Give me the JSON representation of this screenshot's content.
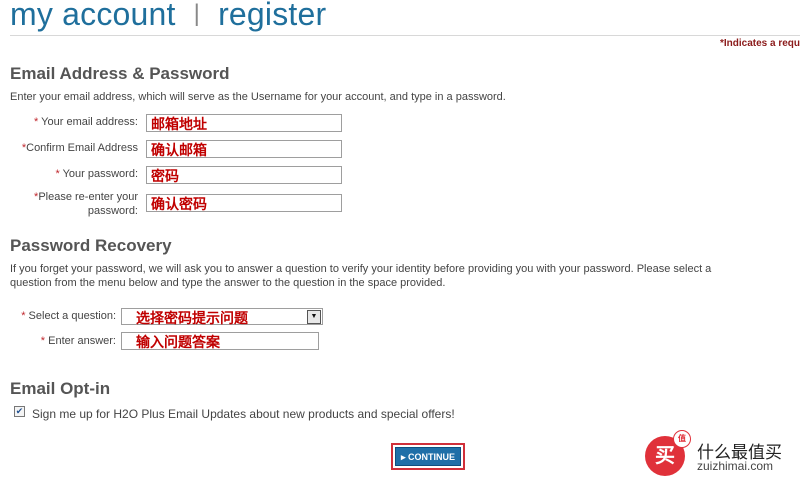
{
  "header": {
    "title_left": "my account",
    "separator": "|",
    "title_right": "register"
  },
  "required_note": "*Indicates a requ",
  "email_section": {
    "heading": "Email Address & Password",
    "description": "Enter your email address, which will serve as the Username for your account, and type in a password.",
    "fields": [
      {
        "star": "*",
        "label": "Your email address:",
        "value": "邮箱地址"
      },
      {
        "star": "*",
        "label": "Confirm Email Address",
        "value": "确认邮箱"
      },
      {
        "star": "*",
        "label": "Your password:",
        "value": "密码"
      },
      {
        "star": "*",
        "label_line1": "Please re-enter your",
        "label_line2": "password:",
        "value": "确认密码"
      }
    ]
  },
  "recovery_section": {
    "heading": "Password Recovery",
    "description_line1": "If you forget your password, we will ask you to answer a question to verify your identity before providing you with your password. Please select a",
    "description_line2": "question from the menu below and type the answer to the question in the space provided.",
    "question": {
      "star": "*",
      "label": "Select a question:",
      "value": "选择密码提示问题"
    },
    "answer": {
      "star": "*",
      "label": "Enter answer:",
      "value": "输入问题答案"
    }
  },
  "optin_section": {
    "heading": "Email Opt-in",
    "checkbox_checked": true,
    "checkbox_label": "Sign me up for H2O Plus Email Updates about new products and special offers!"
  },
  "continue_button": {
    "label": "▸ CONTINUE"
  },
  "watermark": {
    "logo_char": "买",
    "badge": "值",
    "text": "什么最值买",
    "url": "zuizhimai.com"
  }
}
